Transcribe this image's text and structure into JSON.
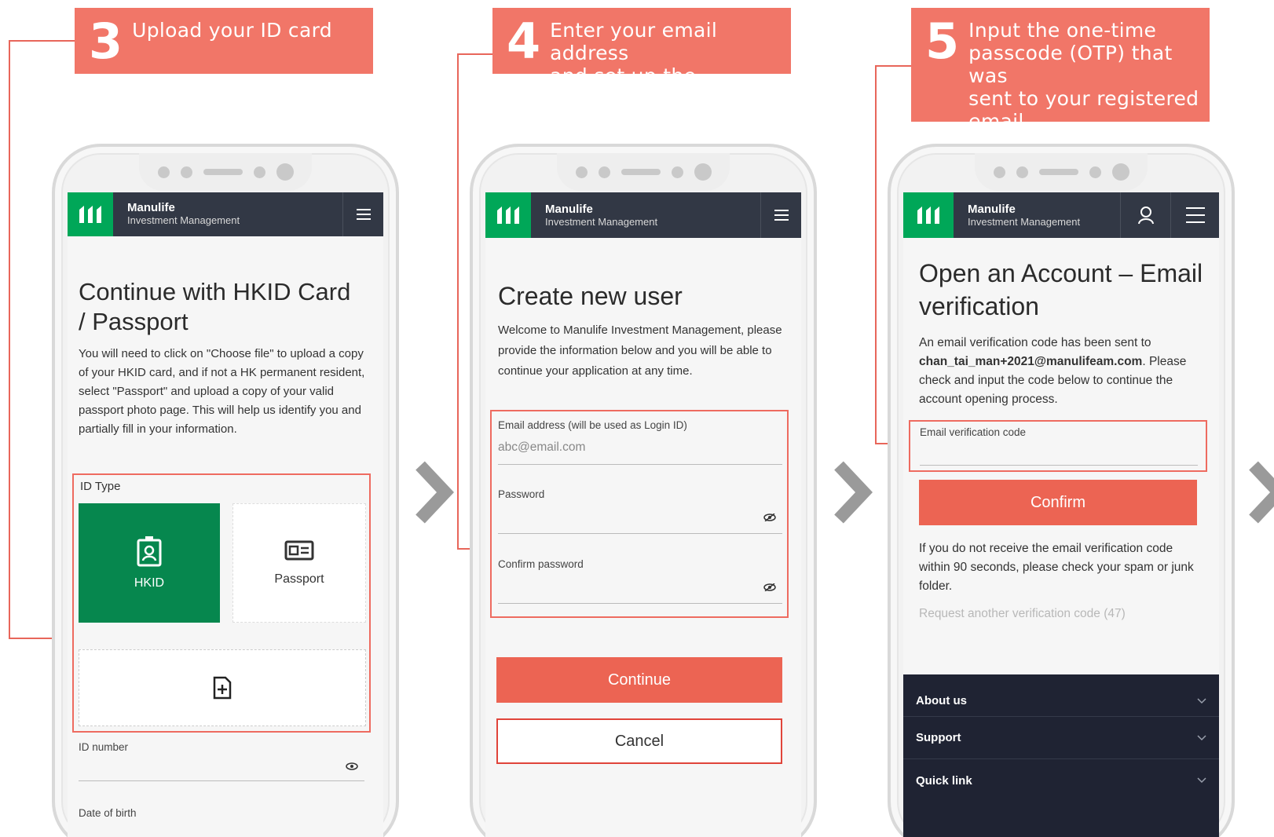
{
  "colors": {
    "accent": "#f17668",
    "button": "#ec6453",
    "brand_green": "#00a758",
    "header": "#323845",
    "footer": "#1f2333",
    "arrow": "#9a9a9a"
  },
  "steps": [
    {
      "number": "3",
      "text": "Upload your ID card"
    },
    {
      "number": "4",
      "text_line1": "Enter your email address",
      "text_line2": "and set up the password"
    },
    {
      "number": "5",
      "text_line1": "Input the one-time",
      "text_line2": "passcode (OTP) that was",
      "text_line3": "sent to your registered",
      "text_line4": "email"
    }
  ],
  "header": {
    "brand": "Manulife",
    "sub": "Investment Management",
    "menu_icon": "hamburger-icon",
    "profile_icon": "user-icon"
  },
  "screen1": {
    "title_line1": "Continue with HKID Card",
    "title_line2": "/ Passport",
    "body": "You will need to click on \"Choose file\" to upload a copy of your HKID card, and if not a HK permanent resident, select \"Passport\" and upload a copy of your valid passport photo page. This will help us identify you and partially fill in your information.",
    "id_type_label": "ID Type",
    "options": [
      {
        "label": "HKID",
        "icon": "id-badge-icon",
        "selected": true
      },
      {
        "label": "Passport",
        "icon": "passport-icon",
        "selected": false
      }
    ],
    "upload_icon": "add-file-icon",
    "id_number_label": "ID number",
    "dob_label": "Date of birth"
  },
  "screen2": {
    "title": "Create new user",
    "body": "Welcome to Manulife Investment Management, please provide the information below and you will be able to continue your application at any time.",
    "email_label": "Email address (will be used as Login ID)",
    "email_placeholder": "abc@email.com",
    "password_label": "Password",
    "confirm_label": "Confirm password",
    "continue": "Continue",
    "cancel": "Cancel"
  },
  "screen3": {
    "title_line1": "Open an Account – Email",
    "title_line2": "verification",
    "body_1": "An email verification code has been sent to",
    "email": "chan_tai_man+2021@manulifeam.com",
    "body_2": "Please check and input the code below to continue the account opening process.",
    "code_label": "Email verification code",
    "confirm": "Confirm",
    "note": "If you do not receive the email verification code within 90 seconds, please check your spam or junk folder.",
    "resend": "Request another verification code (47)",
    "footer": [
      "About us",
      "Support",
      "Quick link"
    ]
  }
}
